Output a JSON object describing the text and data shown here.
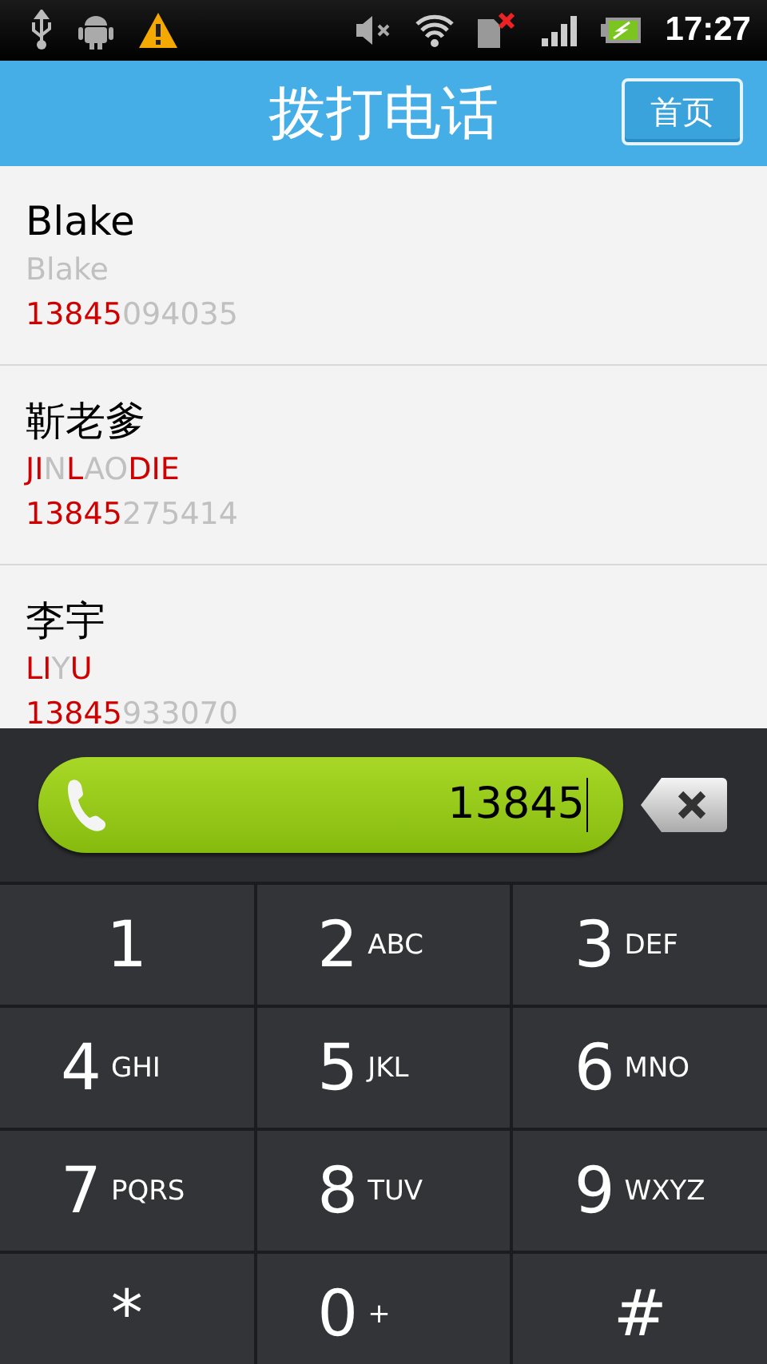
{
  "status_bar": {
    "time": "17:27"
  },
  "header": {
    "title": "拨打电话",
    "home_button": "首页"
  },
  "contacts": [
    {
      "name": "Blake",
      "spelling": [
        {
          "text": "Blake",
          "match": false
        }
      ],
      "phone": [
        {
          "text": "13845",
          "match": true
        },
        {
          "text": "094035",
          "match": false
        }
      ]
    },
    {
      "name": "靳老爹",
      "spelling": [
        {
          "text": "JI",
          "match": true
        },
        {
          "text": "N",
          "match": false
        },
        {
          "text": "L",
          "match": true
        },
        {
          "text": "AO",
          "match": false
        },
        {
          "text": "DIE",
          "match": true
        }
      ],
      "phone": [
        {
          "text": "13845",
          "match": true
        },
        {
          "text": "275414",
          "match": false
        }
      ]
    },
    {
      "name": "李宇",
      "spelling": [
        {
          "text": "LI",
          "match": true
        },
        {
          "text": "Y",
          "match": false
        },
        {
          "text": "U",
          "match": true
        }
      ],
      "phone": [
        {
          "text": "13845",
          "match": true
        },
        {
          "text": "933070",
          "match": false
        }
      ]
    }
  ],
  "dialer": {
    "number": "13845"
  },
  "keys": [
    {
      "digit": "1"
    },
    {
      "digit": "2",
      "letters": "ABC"
    },
    {
      "digit": "3",
      "letters": "DEF"
    },
    {
      "digit": "4",
      "letters": "GHI"
    },
    {
      "digit": "5",
      "letters": "JKL"
    },
    {
      "digit": "6",
      "letters": "MNO"
    },
    {
      "digit": "7",
      "letters": "PQRS"
    },
    {
      "digit": "8",
      "letters": "TUV"
    },
    {
      "digit": "9",
      "letters": "WXYZ"
    },
    {
      "digit": "*"
    },
    {
      "digit": "0",
      "letters": "+"
    },
    {
      "digit": "#"
    }
  ]
}
